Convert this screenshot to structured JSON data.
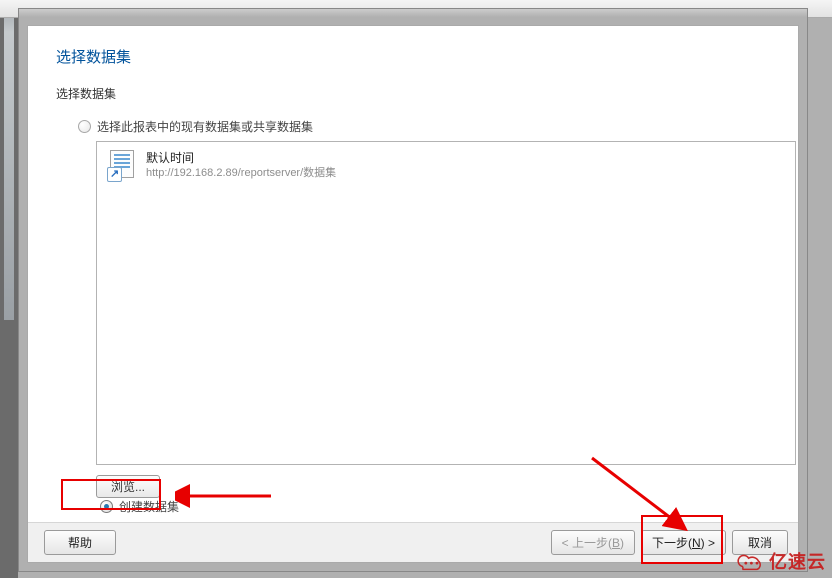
{
  "page": {
    "title": "选择数据集",
    "subtitle": "选择数据集"
  },
  "options": {
    "existing": {
      "label": "选择此报表中的现有数据集或共享数据集",
      "selected": false
    },
    "create": {
      "label": "创建数据集",
      "selected": true
    }
  },
  "dataset": {
    "name": "默认时间",
    "path": "http://192.168.2.89/reportserver/数据集"
  },
  "buttons": {
    "browse": "浏览...",
    "help": "帮助",
    "back": "< 上一步",
    "back_mn": "B",
    "next": "下一步",
    "next_mn": "N",
    "next_suffix": " >",
    "cancel": "取消"
  },
  "watermark": {
    "text": "亿速云"
  }
}
